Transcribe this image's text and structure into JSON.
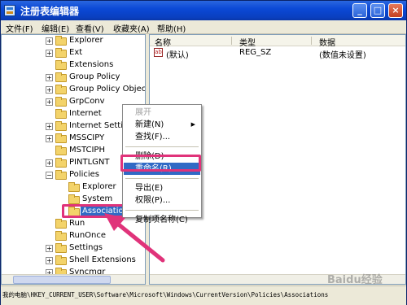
{
  "window": {
    "title": "注册表编辑器"
  },
  "menubar": [
    "文件(F)",
    "编辑(E)",
    "查看(V)",
    "收藏夹(A)",
    "帮助(H)"
  ],
  "tree": {
    "items": [
      {
        "label": "Explorer",
        "expander": "+"
      },
      {
        "label": "Ext",
        "expander": "+"
      },
      {
        "label": "Extensions",
        "expander": ""
      },
      {
        "label": "Group Policy",
        "expander": "+"
      },
      {
        "label": "Group Policy Object",
        "expander": "+"
      },
      {
        "label": "GrpConv",
        "expander": "+"
      },
      {
        "label": "Internet",
        "expander": ""
      },
      {
        "label": "Internet Settings",
        "expander": "+"
      },
      {
        "label": "MSSCIPY",
        "expander": "+"
      },
      {
        "label": "MSTCIPH",
        "expander": ""
      },
      {
        "label": "PINTLGNT",
        "expander": "+"
      },
      {
        "label": "Policies",
        "expander": "−"
      },
      {
        "label": "Explorer",
        "expander": "",
        "child": true
      },
      {
        "label": "System",
        "expander": "",
        "child": true
      },
      {
        "label": "Associations",
        "expander": "",
        "child": true,
        "selected": true
      },
      {
        "label": "Run",
        "expander": ""
      },
      {
        "label": "RunOnce",
        "expander": ""
      },
      {
        "label": "Settings",
        "expander": "+"
      },
      {
        "label": "Shell Extensions",
        "expander": "+"
      },
      {
        "label": "Syncmgr",
        "expander": "+"
      }
    ]
  },
  "list": {
    "columns": [
      "名称",
      "类型",
      "数据"
    ],
    "rows": [
      {
        "name": "(默认)",
        "type": "REG_SZ",
        "data": "(数值未设置)",
        "icon": "ab-icon"
      }
    ]
  },
  "context_menu": {
    "items": [
      {
        "label": "展开",
        "disabled": true
      },
      {
        "label": "新建(N)",
        "submenu": true
      },
      {
        "label": "查找(F)..."
      },
      {
        "separator": true
      },
      {
        "label": "删除(D)"
      },
      {
        "label": "重命名(R)",
        "highlight": true
      },
      {
        "separator": true
      },
      {
        "label": "导出(E)"
      },
      {
        "label": "权限(P)..."
      },
      {
        "separator": true
      },
      {
        "label": "复制项名称(C)"
      }
    ]
  },
  "statusbar": {
    "path": "我的电脑\\HKEY_CURRENT_USER\\Software\\Microsoft\\Windows\\CurrentVersion\\Policies\\Associations"
  },
  "watermark": "Baidu经验",
  "colors": {
    "highlight": "#316ac5",
    "annotation": "#e0337a",
    "titlebar": "#0b49d6"
  }
}
